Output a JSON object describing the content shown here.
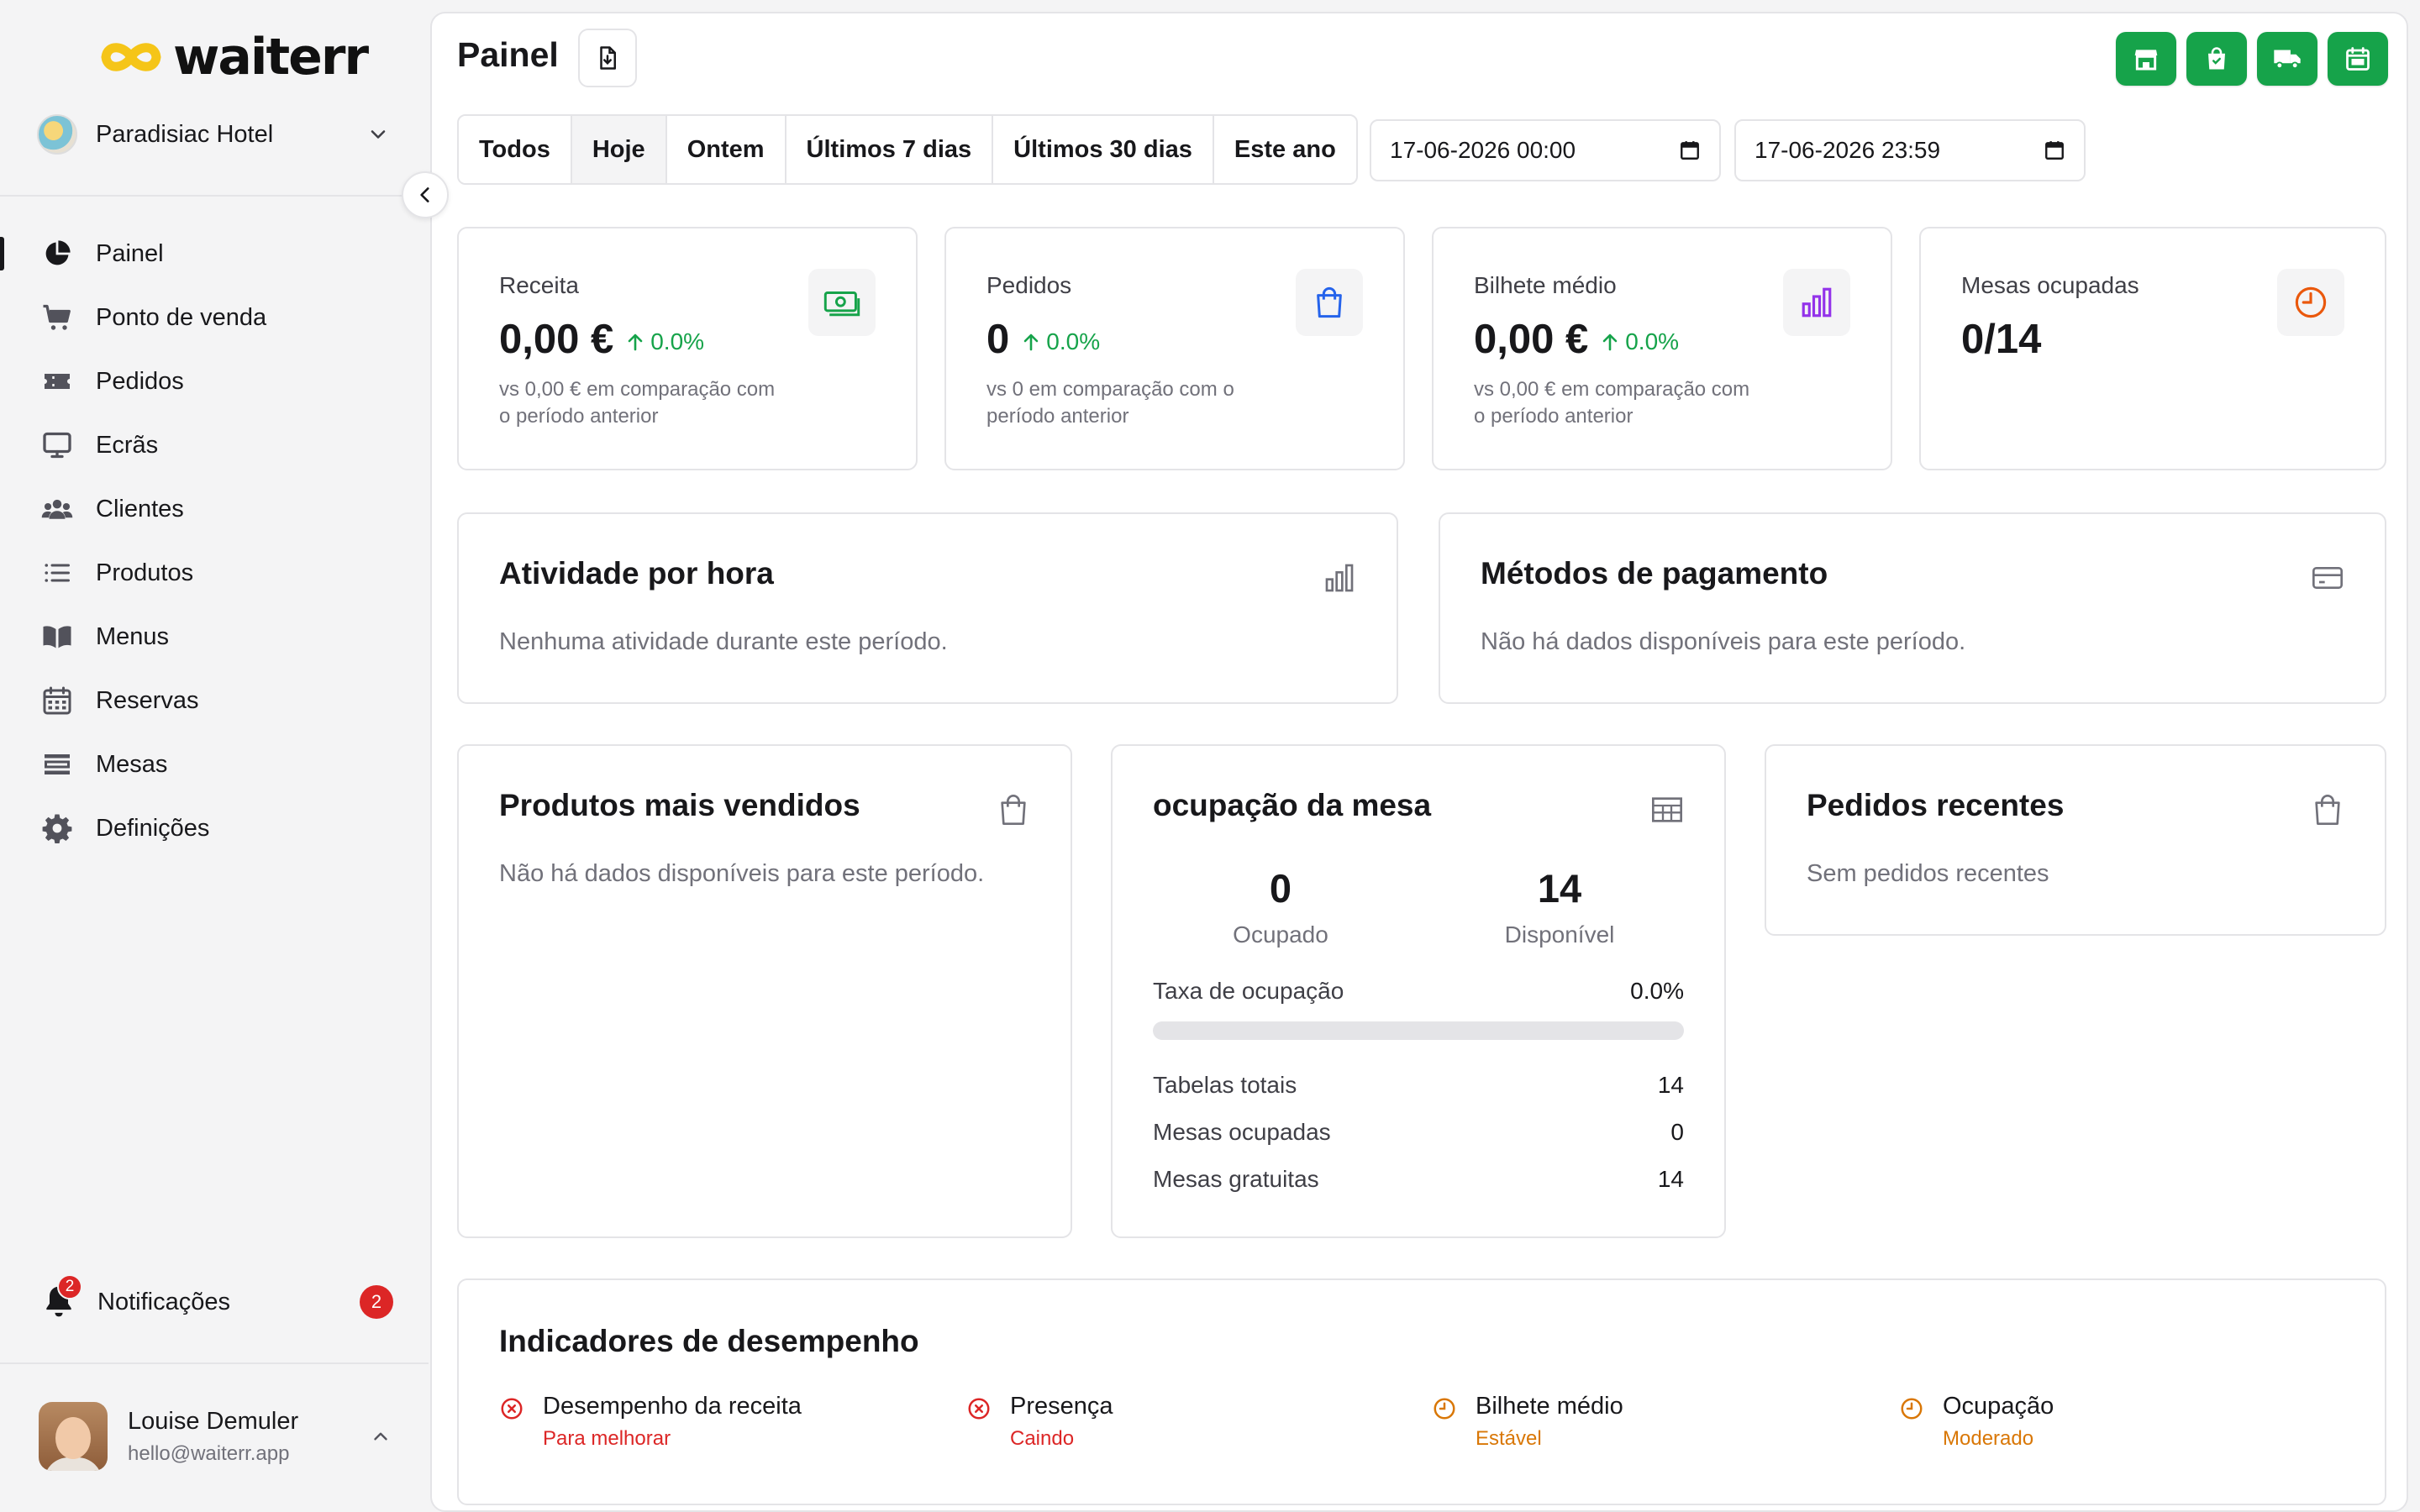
{
  "brand": {
    "name": "waiterr",
    "accent": "#16a34a",
    "logo_yellow": "#f5c518"
  },
  "venue": {
    "name": "Paradisiac Hotel"
  },
  "nav": {
    "items": [
      {
        "label": "Painel",
        "icon": "pie-chart-icon",
        "active": true
      },
      {
        "label": "Ponto de venda",
        "icon": "cart-icon"
      },
      {
        "label": "Pedidos",
        "icon": "ticket-icon"
      },
      {
        "label": "Ecrãs",
        "icon": "monitor-icon"
      },
      {
        "label": "Clientes",
        "icon": "users-icon"
      },
      {
        "label": "Produtos",
        "icon": "list-icon"
      },
      {
        "label": "Menus",
        "icon": "book-icon"
      },
      {
        "label": "Reservas",
        "icon": "calendar-icon"
      },
      {
        "label": "Mesas",
        "icon": "table-icon"
      },
      {
        "label": "Definições",
        "icon": "gear-icon"
      }
    ]
  },
  "notifications": {
    "label": "Notificações",
    "count": "2",
    "bell_badge": "2"
  },
  "user": {
    "name": "Louise Demuler",
    "email": "hello@waiterr.app"
  },
  "header": {
    "title": "Painel",
    "quick_actions": [
      "store-icon",
      "shopping-bag-icon",
      "truck-icon",
      "calendar-icon"
    ]
  },
  "ranges": [
    "Todos",
    "Hoje",
    "Ontem",
    "Últimos 7 dias",
    "Últimos 30 dias",
    "Este ano"
  ],
  "active_range": "Hoje",
  "dates": {
    "start": "17-06-2026 00:00",
    "end": "17-06-2026 23:59"
  },
  "kpis": [
    {
      "label": "Receita",
      "value": "0,00 €",
      "delta": "0.0%",
      "sub": "vs 0,00 € em comparação com o período anterior",
      "icon": "cash-icon",
      "icon_color": "#16a34a"
    },
    {
      "label": "Pedidos",
      "value": "0",
      "delta": "0.0%",
      "sub": "vs 0 em comparação com o período anterior",
      "icon": "shopping-bag-icon",
      "icon_color": "#2563eb"
    },
    {
      "label": "Bilhete médio",
      "value": "0,00 €",
      "delta": "0.0%",
      "sub": "vs 0,00 € em comparação com o período anterior",
      "icon": "bar-chart-icon",
      "icon_color": "#9333ea"
    },
    {
      "label": "Mesas ocupadas",
      "value": "0/14",
      "icon": "clock-icon",
      "icon_color": "#ea580c"
    }
  ],
  "hourly": {
    "title": "Atividade por hora",
    "empty": "Nenhuma atividade durante este período."
  },
  "payments": {
    "title": "Métodos de pagamento",
    "empty": "Não há dados disponíveis para este período."
  },
  "top_products": {
    "title": "Produtos mais vendidos",
    "empty": "Não há dados disponíveis para este período."
  },
  "occupancy": {
    "title": "ocupação da mesa",
    "occupied_value": "0",
    "occupied_label": "Ocupado",
    "available_value": "14",
    "available_label": "Disponível",
    "rate_label": "Taxa de ocupação",
    "rate_value": "0.0%",
    "rate_fraction": 0,
    "rows": [
      {
        "label": "Tabelas totais",
        "value": "14"
      },
      {
        "label": "Mesas ocupadas",
        "value": "0"
      },
      {
        "label": "Mesas gratuitas",
        "value": "14"
      }
    ]
  },
  "recent_orders": {
    "title": "Pedidos recentes",
    "empty": "Sem pedidos recentes"
  },
  "indicators": {
    "title": "Indicadores de desempenho",
    "items": [
      {
        "title": "Desempenho da receita",
        "status": "Para melhorar",
        "color": "#dc2626",
        "icon": "x-circle-icon"
      },
      {
        "title": "Presença",
        "status": "Caindo",
        "color": "#dc2626",
        "icon": "x-circle-icon"
      },
      {
        "title": "Bilhete médio",
        "status": "Estável",
        "color": "#d97706",
        "icon": "clock-icon"
      },
      {
        "title": "Ocupação",
        "status": "Moderado",
        "color": "#d97706",
        "icon": "clock-icon"
      }
    ]
  }
}
